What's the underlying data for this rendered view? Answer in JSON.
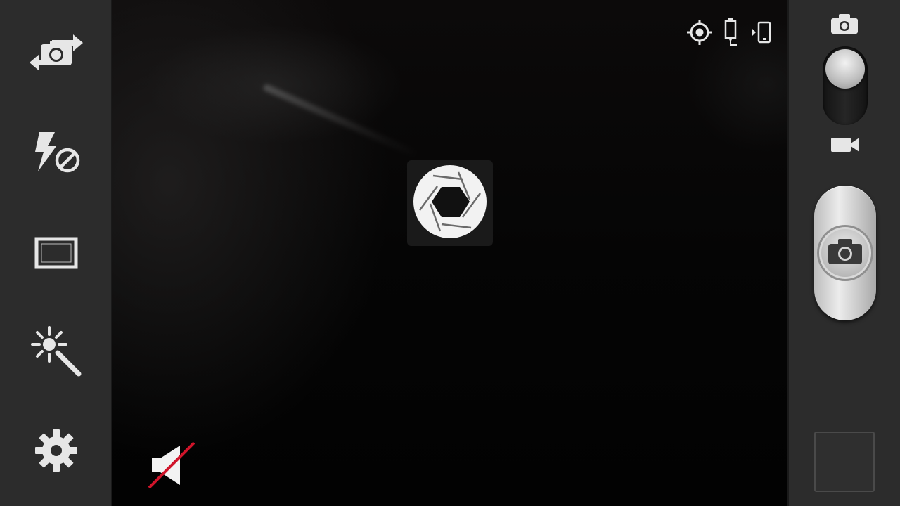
{
  "app": {
    "name": "Camera"
  },
  "left_panel": {
    "items": [
      {
        "icon": "switch-camera-icon"
      },
      {
        "icon": "flash-off-icon"
      },
      {
        "icon": "aspect-ratio-icon"
      },
      {
        "icon": "effects-magic-wand-icon"
      },
      {
        "icon": "settings-gear-icon"
      }
    ]
  },
  "viewfinder": {
    "status_icons": [
      "gps-target-icon",
      "battery-charging-icon",
      "storage-phone-icon"
    ],
    "center_indicator": "aperture-shutter-icon",
    "sound": "mute-icon"
  },
  "right_panel": {
    "mode_switch": {
      "selected_mode": "camera",
      "top_icon": "camera-icon",
      "bottom_icon": "video-camera-icon"
    },
    "shutter_icon": "camera-icon",
    "thumbnail": "gallery-thumbnail"
  },
  "colors": {
    "panel": "#2c2c2c",
    "viewfinder": "#000000",
    "icon": "#e6e6e6",
    "mute_slash": "#d0142a"
  }
}
